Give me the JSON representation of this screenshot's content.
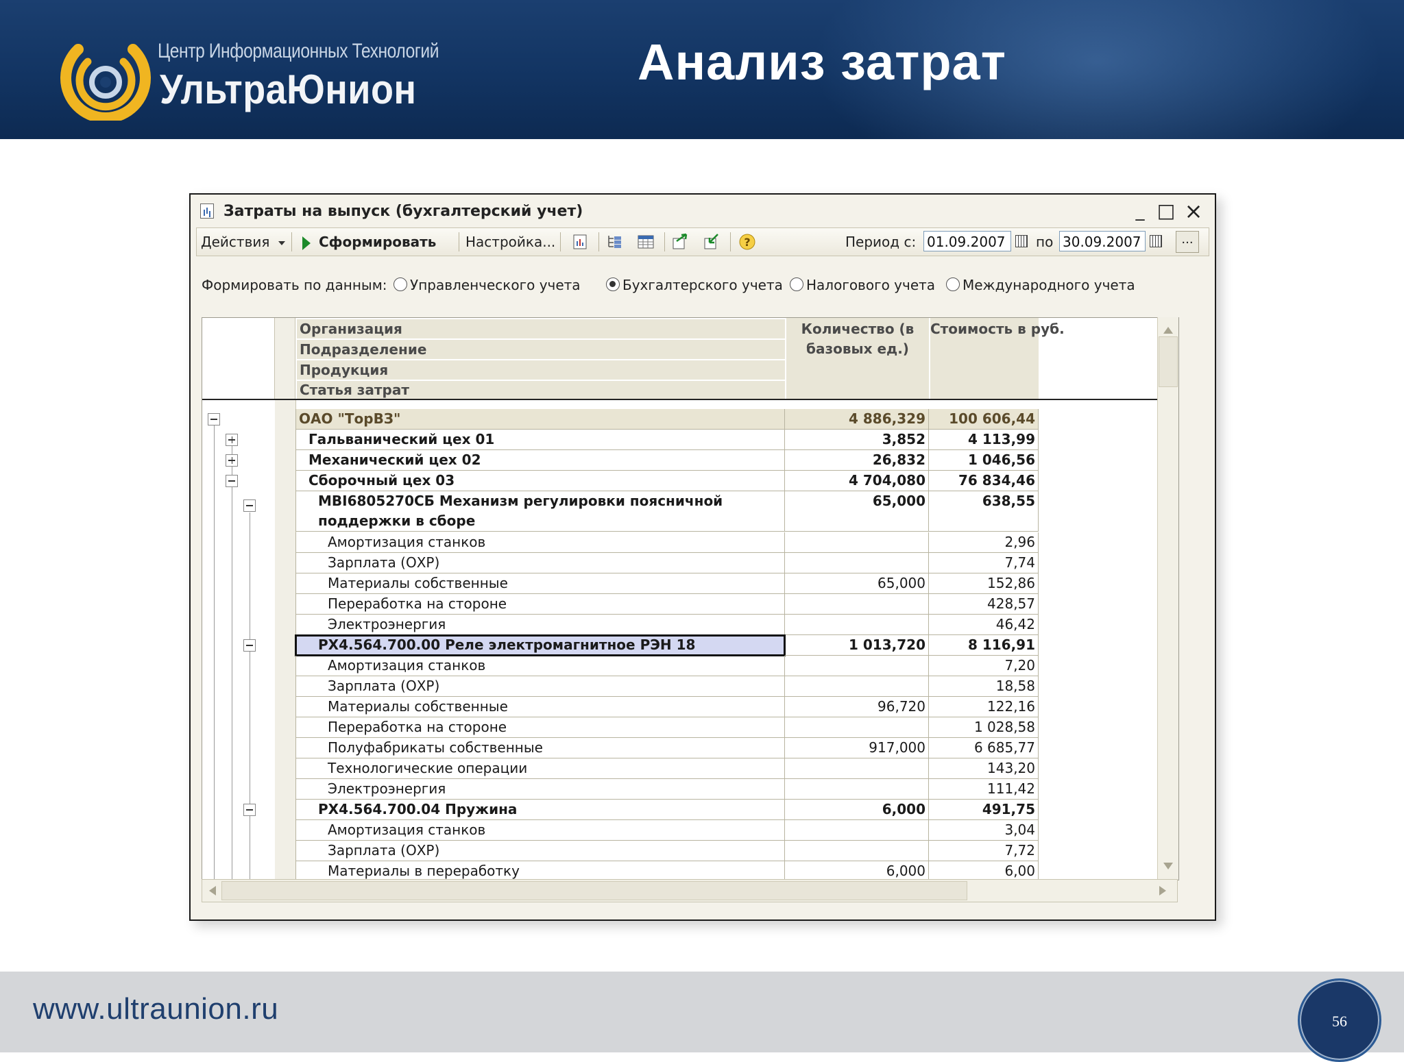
{
  "slide": {
    "title": "Анализ затрат",
    "logo_line1": "Центр Информационных Технологий",
    "logo_line2": "УльтраЮнион",
    "url": "www.ultraunion.ru",
    "page_number": "56"
  },
  "window": {
    "title": "Затраты на выпуск (бухгалтерский учет)",
    "controls": {
      "minimize": "_",
      "maximize": "□",
      "close": "×"
    }
  },
  "toolbar": {
    "actions_label": "Действия",
    "generate_label": "Сформировать",
    "settings_label": "Настройка...",
    "period_from_label": "Период с:",
    "period_from_value": "01.09.2007",
    "period_to_label": "по",
    "period_to_value": "30.09.2007",
    "more_label": "..."
  },
  "data_source": {
    "label": "Формировать по данным:",
    "options": [
      {
        "label": "Управленческого учета",
        "selected": false
      },
      {
        "label": "Бухгалтерского учета",
        "selected": true
      },
      {
        "label": "Налогового учета",
        "selected": false
      },
      {
        "label": "Международного учета",
        "selected": false
      }
    ]
  },
  "report": {
    "group_headers": [
      "Организация",
      "Подразделение",
      "Продукция",
      "Статья затрат"
    ],
    "qty_header_line1": "Количество (в",
    "qty_header_line2": "базовых ед.)",
    "cost_header": "Стоимость в руб.",
    "rows": [
      {
        "name": "ОАО \"ТорВЗ\"",
        "qty": "4 886,329",
        "cost": "100 606,44"
      },
      {
        "name": "Гальванический цех 01",
        "qty": "3,852",
        "cost": "4 113,99"
      },
      {
        "name": "Механический цех 02",
        "qty": "26,832",
        "cost": "1 046,56"
      },
      {
        "name": "Сборочный цех 03",
        "qty": "4 704,080",
        "cost": "76 834,46"
      },
      {
        "name": "МВІ6805270СБ Механизм регулировки поясничной",
        "name2": "поддержки в сборе",
        "qty": "65,000",
        "cost": "638,55"
      },
      {
        "name": "Амортизация станков",
        "qty": "",
        "cost": "2,96"
      },
      {
        "name": "Зарплата (ОХР)",
        "qty": "",
        "cost": "7,74"
      },
      {
        "name": "Материалы собственные",
        "qty": "65,000",
        "cost": "152,86"
      },
      {
        "name": "Переработка на стороне",
        "qty": "",
        "cost": "428,57"
      },
      {
        "name": "Электроэнергия",
        "qty": "",
        "cost": "46,42"
      },
      {
        "name": "РХ4.564.700.00 Реле электромагнитное РЭН 18",
        "qty": "1 013,720",
        "cost": "8 116,91"
      },
      {
        "name": "Амортизация станков",
        "qty": "",
        "cost": "7,20"
      },
      {
        "name": "Зарплата (ОХР)",
        "qty": "",
        "cost": "18,58"
      },
      {
        "name": "Материалы собственные",
        "qty": "96,720",
        "cost": "122,16"
      },
      {
        "name": "Переработка на стороне",
        "qty": "",
        "cost": "1 028,58"
      },
      {
        "name": "Полуфабрикаты собственные",
        "qty": "917,000",
        "cost": "6 685,77"
      },
      {
        "name": "Технологические операции",
        "qty": "",
        "cost": "143,20"
      },
      {
        "name": "Электроэнергия",
        "qty": "",
        "cost": "111,42"
      },
      {
        "name": "РХ4.564.700.04 Пружина",
        "qty": "6,000",
        "cost": "491,75"
      },
      {
        "name": "Амортизация станков",
        "qty": "",
        "cost": "3,04"
      },
      {
        "name": "Зарплата (ОХР)",
        "qty": "",
        "cost": "7,72"
      },
      {
        "name": "Материалы в переработку",
        "qty": "6,000",
        "cost": "6,00"
      }
    ]
  },
  "colors": {
    "header_bg": "#123462",
    "selected_row": "#d4d8f2",
    "header_cell": "#e9e6d7",
    "logo_gold": "#f0b521"
  },
  "icons": [
    "chart-icon",
    "play-icon",
    "report-icon",
    "tree-icon",
    "table-icon",
    "export-icon",
    "import-icon",
    "help-icon",
    "calendar-icon"
  ]
}
